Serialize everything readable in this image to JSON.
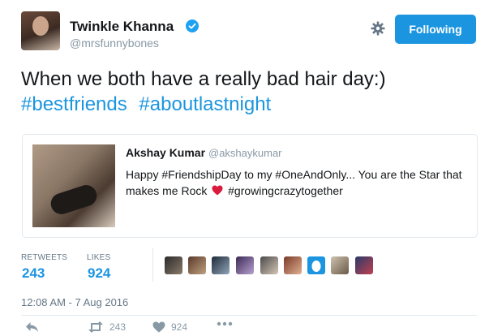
{
  "author": {
    "name": "Twinkle Khanna",
    "handle": "@mrsfunnybones",
    "follow_label": "Following"
  },
  "tweet": {
    "text": "When we both have a really bad hair day:)",
    "hashtags": [
      "#bestfriends",
      "#aboutlastnight"
    ]
  },
  "quote": {
    "name": "Akshay Kumar",
    "handle": "@akshaykumar",
    "text_before": "Happy #FriendshipDay to my #OneAndOnly... You are the Star that makes me Rock",
    "text_after": "#growingcrazytogether"
  },
  "stats": {
    "retweets_label": "RETWEETS",
    "retweets_value": "243",
    "likes_label": "LIKES",
    "likes_value": "924"
  },
  "timestamp": "12:08 AM - 7 Aug 2016",
  "actions": {
    "retweet_count": "243",
    "like_count": "924"
  },
  "colors": {
    "accent": "#1b95e0",
    "heart": "#e0245e"
  },
  "icons": {
    "verified": "verified-badge-icon",
    "settings": "gear-icon",
    "reply": "reply-icon",
    "retweet": "retweet-icon",
    "like": "heart-icon",
    "more": "more-icon"
  }
}
